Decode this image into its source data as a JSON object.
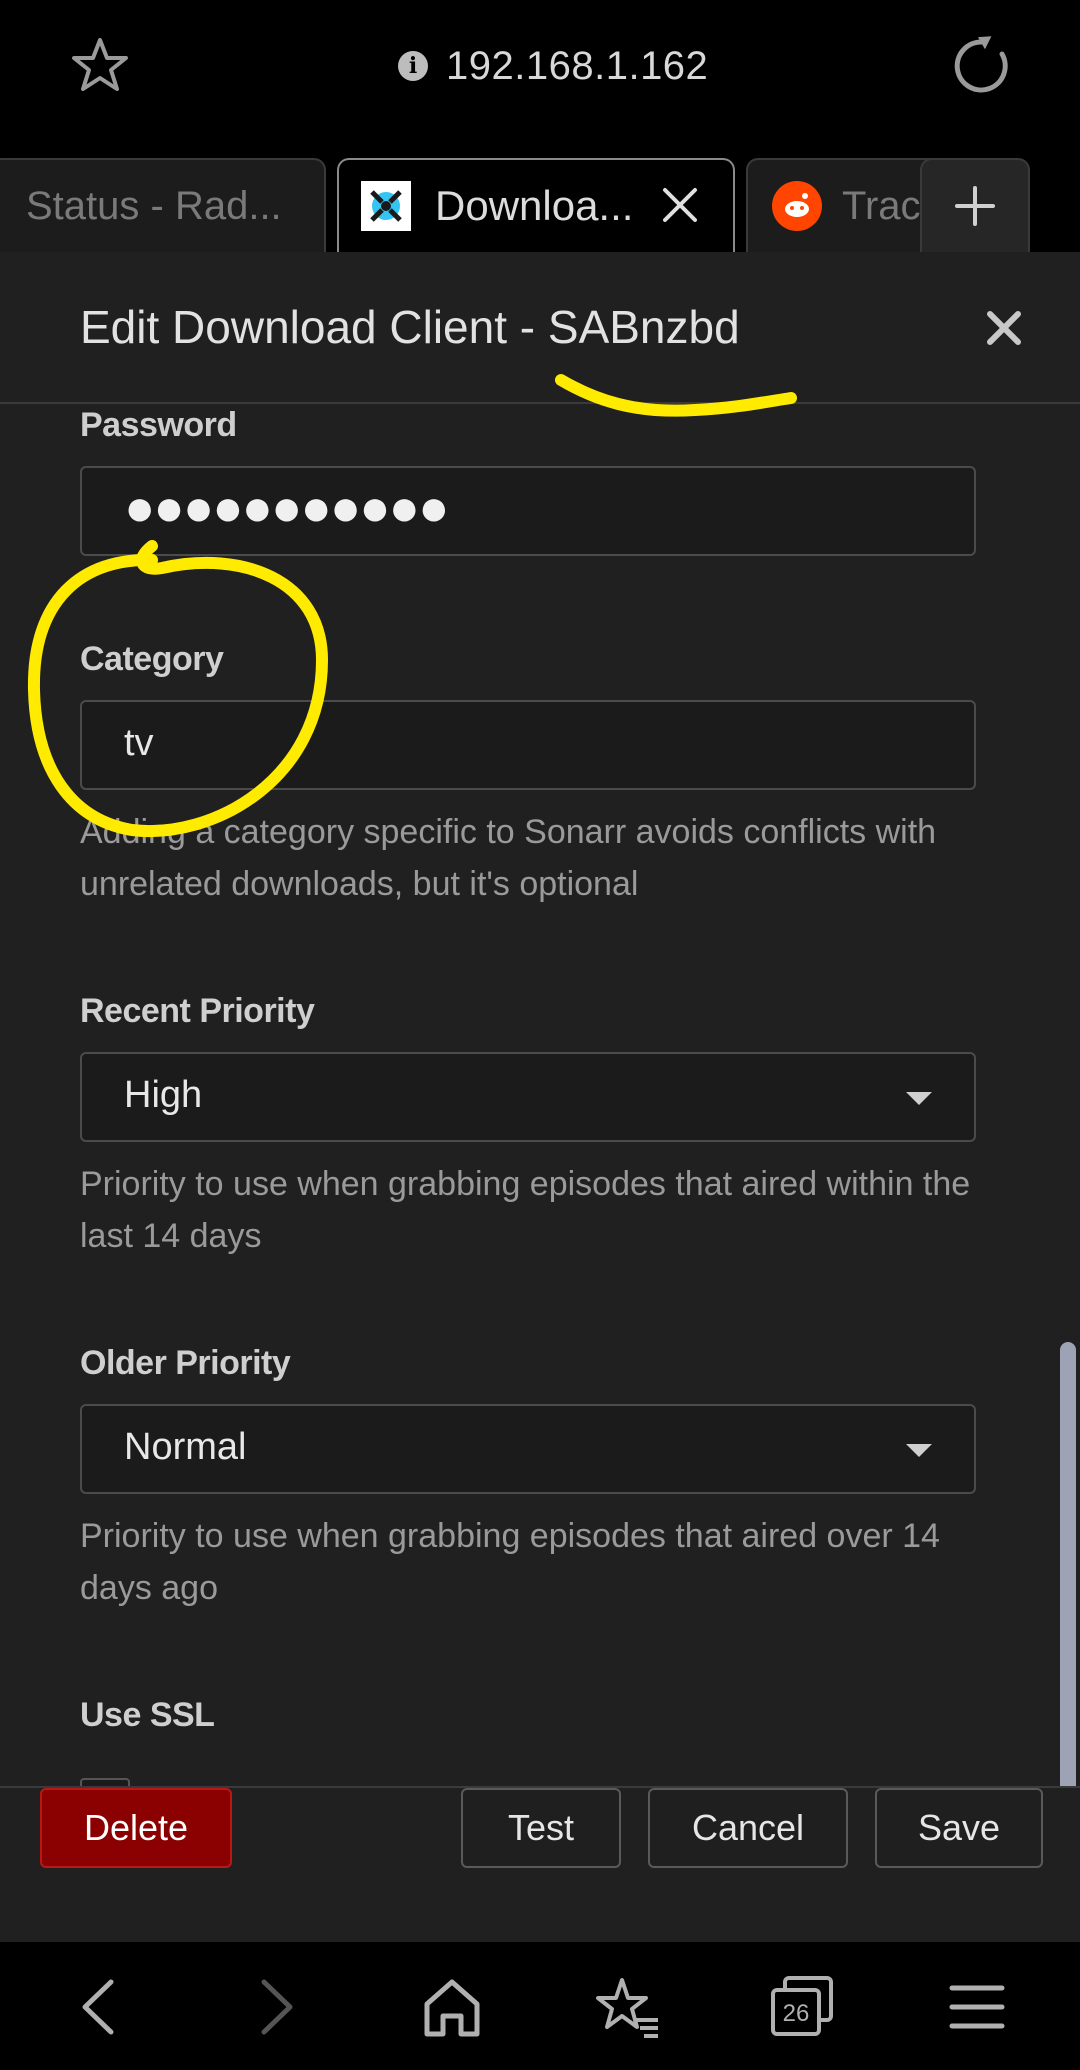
{
  "browser": {
    "url": "192.168.1.162",
    "tabs": [
      {
        "label": "Status - Rad..."
      },
      {
        "label": "Downloa..."
      },
      {
        "label": "Trac"
      }
    ],
    "tab_count": "26"
  },
  "modal": {
    "title": "Edit Download Client - SABnzbd",
    "fields": {
      "password": {
        "label": "Password",
        "value": "●●●●●●●●●●●"
      },
      "category": {
        "label": "Category",
        "value": "tv",
        "help": "Adding a category specific to Sonarr avoids conflicts with unrelated downloads, but it's optional"
      },
      "recent_priority": {
        "label": "Recent Priority",
        "value": "High",
        "help": "Priority to use when grabbing episodes that aired within the last 14 days"
      },
      "older_priority": {
        "label": "Older Priority",
        "value": "Normal",
        "help": "Priority to use when grabbing episodes that aired over 14 days ago"
      },
      "use_ssl": {
        "label": "Use SSL"
      }
    },
    "buttons": {
      "delete": "Delete",
      "test": "Test",
      "cancel": "Cancel",
      "save": "Save"
    }
  },
  "colors": {
    "delete_bg": "#8b0000",
    "annotation": "#ffeb00",
    "modal_bg": "#202020"
  }
}
